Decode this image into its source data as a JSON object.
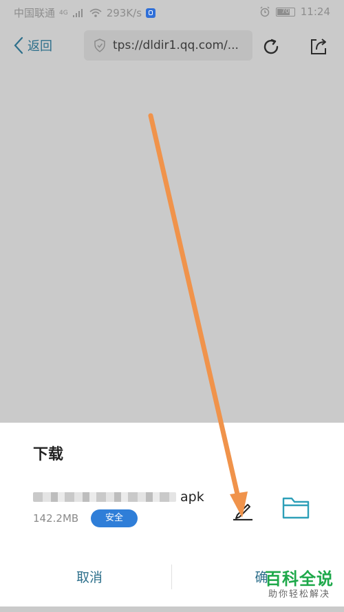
{
  "status_bar": {
    "carrier": "中国联通",
    "network": "4G",
    "speed": "293K/s",
    "battery": "70",
    "time": "11:24"
  },
  "browser": {
    "back_label": "返回",
    "url": "tps://dldir1.qq.com/..."
  },
  "download_sheet": {
    "title": "下载",
    "file_name_suffix": "apk",
    "file_size": "142.2MB",
    "safe_badge": "安全",
    "cancel_label": "取消",
    "confirm_label": "确"
  },
  "watermark": {
    "main": "百科全说",
    "sub": "助你轻松解决"
  },
  "colors": {
    "accent": "#2d6f8b",
    "badge": "#2f7ed8",
    "arrow": "#f0934b",
    "watermark": "#1ea84a"
  }
}
